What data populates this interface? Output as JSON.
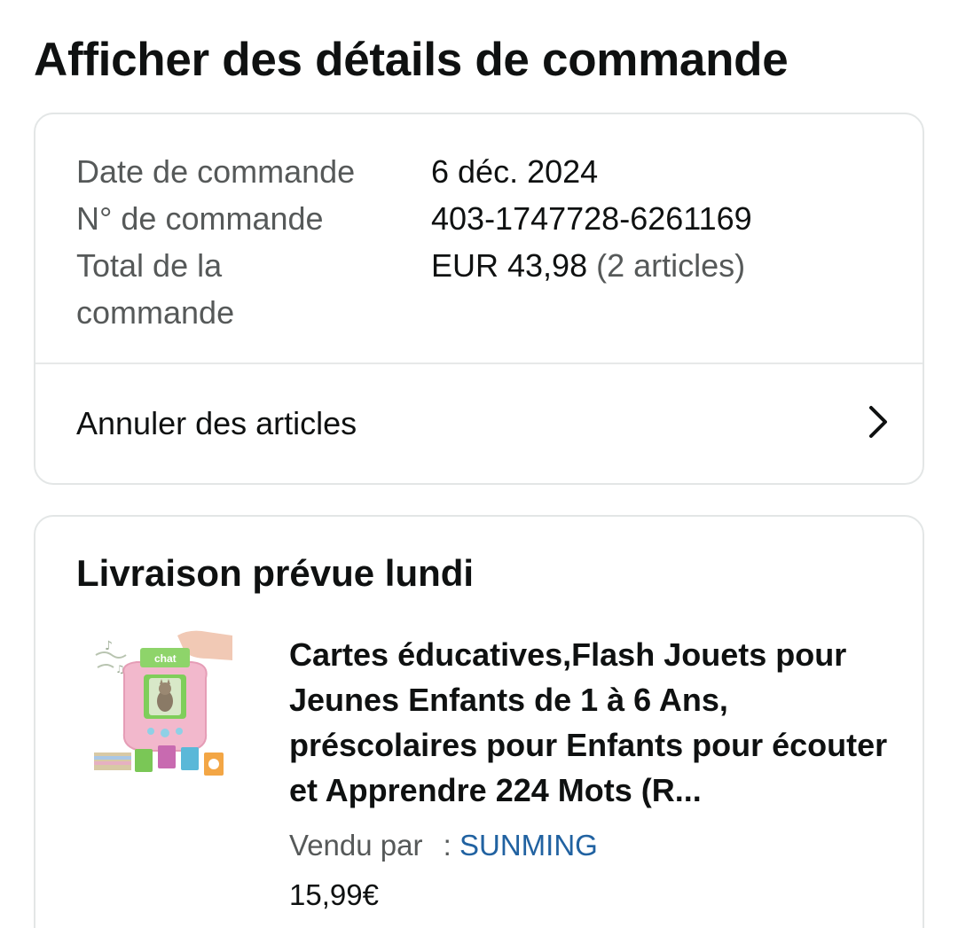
{
  "page": {
    "title": "Afficher des détails de commande"
  },
  "summary": {
    "rows": [
      {
        "label": "Date de commande",
        "value": "6 déc. 2024"
      },
      {
        "label": "N° de commande",
        "value": "403-1747728-6261169"
      },
      {
        "label": "Total de la commande",
        "value": "EUR 43,98",
        "extra": "(2 articles)"
      }
    ],
    "cancel_label": "Annuler des articles",
    "cancel_icon": "chevron-right-icon"
  },
  "delivery": {
    "title": "Livraison prévue lundi",
    "product": {
      "title": "Cartes éducatives,Flash Jouets pour Jeunes Enfants de 1 à 6 Ans, préscolaires pour Enfants pour écouter et Apprendre 224 Mots (R...",
      "image_label": "chat",
      "seller_prefix": "Vendu par",
      "seller_sep": ":",
      "seller_name": "SUNMING",
      "price": "15,99€"
    }
  },
  "colors": {
    "text": "#0f1111",
    "muted": "#565959",
    "link": "#2162a1",
    "border": "#e3e6e6"
  }
}
